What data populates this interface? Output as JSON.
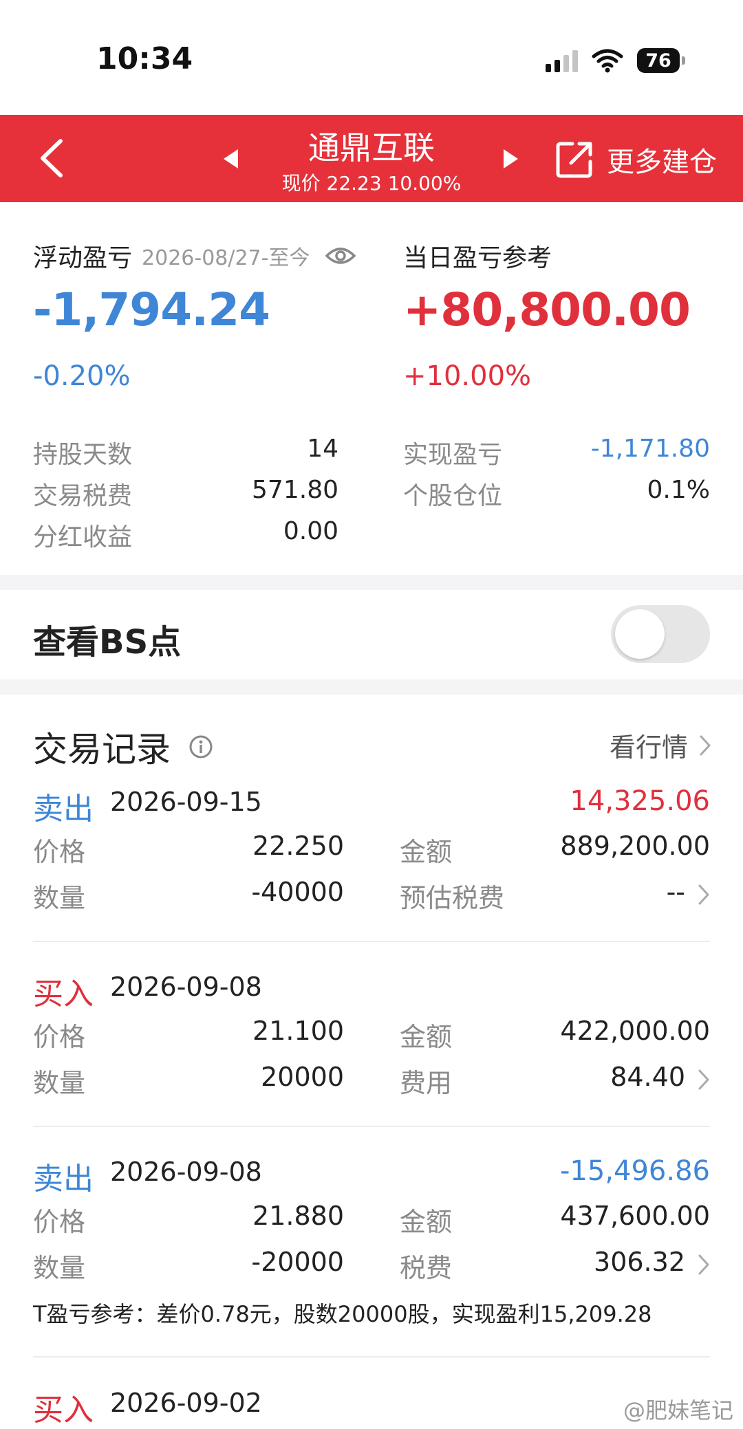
{
  "status_bar": {
    "time": "10:34",
    "battery": "76"
  },
  "header": {
    "title": "通鼎互联",
    "subtitle": "现价 22.23 10.00%",
    "action_label": "更多建仓"
  },
  "summary": {
    "floating": {
      "label": "浮动盈亏",
      "date": "2026-08/27-至今",
      "value": "-1,794.24",
      "pct": "-0.20%"
    },
    "daily": {
      "label": "当日盈亏参考",
      "value": "+80,800.00",
      "pct": "+10.00%"
    },
    "left_stats": [
      {
        "label": "持股天数",
        "value": "14"
      },
      {
        "label": "交易税费",
        "value": "571.80"
      },
      {
        "label": "分红收益",
        "value": "0.00"
      }
    ],
    "right_stats": [
      {
        "label": "实现盈亏",
        "value": "-1,171.80"
      },
      {
        "label": "个股仓位",
        "value": "0.1%"
      }
    ]
  },
  "bs_toggle": {
    "label": "查看BS点",
    "enabled": false
  },
  "trades": {
    "title": "交易记录",
    "link_label": "看行情",
    "records": [
      {
        "type": "卖出",
        "date": "2026-09-15",
        "pl": "14,325.06",
        "price_label": "价格",
        "price": "22.250",
        "qty_label": "数量",
        "qty": "-40000",
        "amount_label": "金额",
        "amount": "889,200.00",
        "fee_label": "预估税费",
        "fee": "--"
      },
      {
        "type": "买入",
        "date": "2026-09-08",
        "pl": "",
        "price_label": "价格",
        "price": "21.100",
        "qty_label": "数量",
        "qty": "20000",
        "amount_label": "金额",
        "amount": "422,000.00",
        "fee_label": "费用",
        "fee": "84.40"
      },
      {
        "type": "卖出",
        "date": "2026-09-08",
        "pl": "-15,496.86",
        "price_label": "价格",
        "price": "21.880",
        "qty_label": "数量",
        "qty": "-20000",
        "amount_label": "金额",
        "amount": "437,600.00",
        "fee_label": "税费",
        "fee": "306.32",
        "t_ref": "T盈亏参考：差价0.78元，股数20000股，实现盈利15,209.28"
      },
      {
        "type": "买入",
        "date": "2026-09-02"
      }
    ]
  },
  "watermark": "@肥妹笔记",
  "colors": {
    "brand_red": "#e6313a",
    "loss_blue": "#3f86d6",
    "gain_red": "#e0303c"
  }
}
